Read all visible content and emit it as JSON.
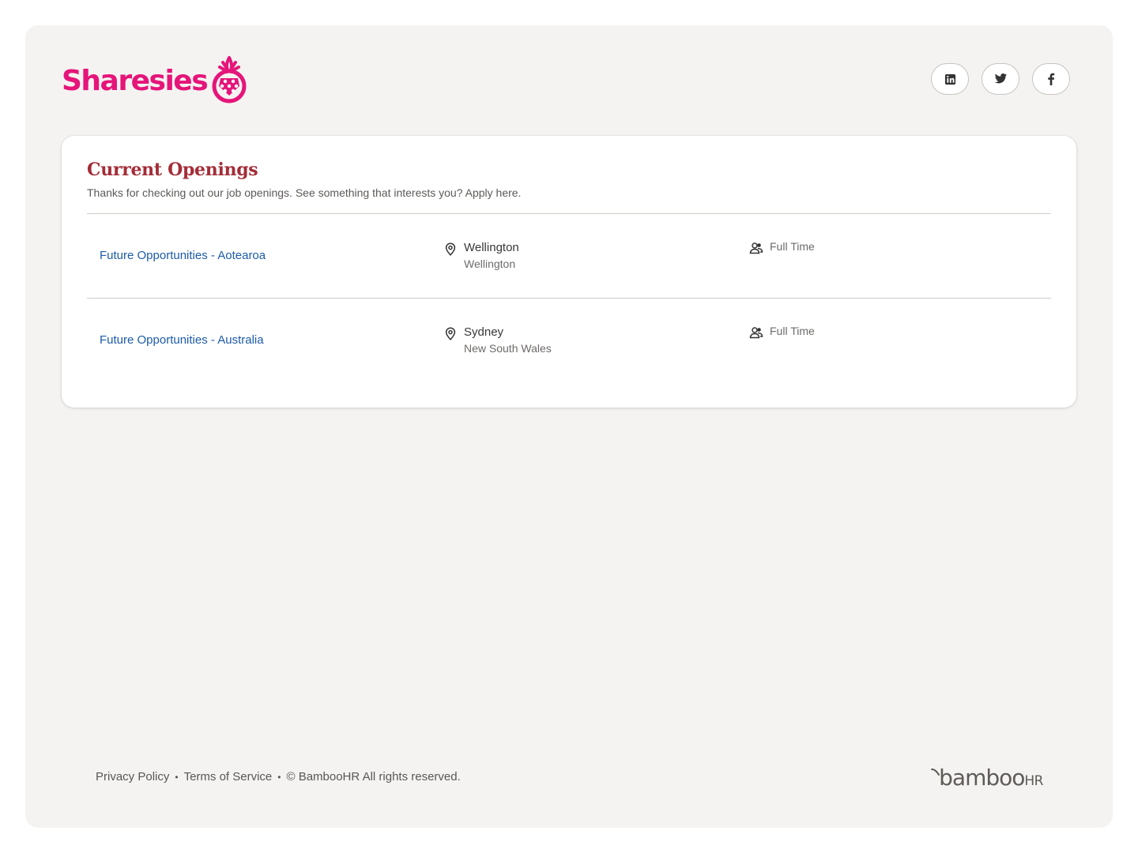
{
  "brand": {
    "logo_text": "Sharesies",
    "logo_color": "#e5157a"
  },
  "social": [
    {
      "name": "linkedin-icon"
    },
    {
      "name": "twitter-icon"
    },
    {
      "name": "facebook-icon"
    }
  ],
  "openings": {
    "title": "Current Openings",
    "subtitle": "Thanks for checking out our job openings. See something that interests you? Apply here.",
    "title_color": "#a32d37",
    "link_color": "#1d5ba8",
    "jobs": [
      {
        "title": "Future Opportunities - Aotearoa",
        "city": "Wellington",
        "region": "Wellington",
        "type": "Full Time"
      },
      {
        "title": "Future Opportunities - Australia",
        "city": "Sydney",
        "region": "New South Wales",
        "type": "Full Time"
      }
    ]
  },
  "footer": {
    "privacy": "Privacy Policy",
    "separator": "•",
    "terms": "Terms of Service",
    "copyright": "© BambooHR All rights reserved.",
    "vendor_logo": "bamboo",
    "vendor_logo_suffix": "HR"
  }
}
